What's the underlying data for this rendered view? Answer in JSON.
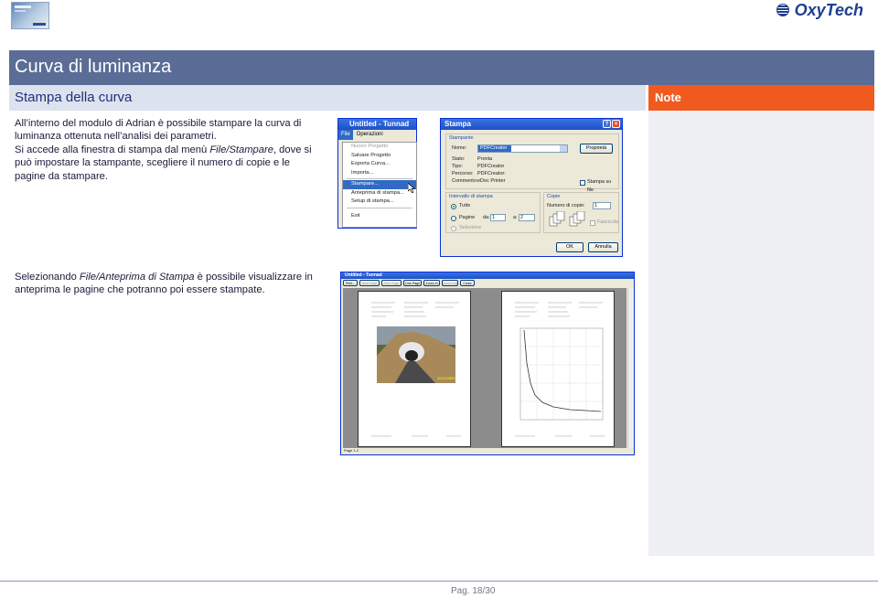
{
  "header": {
    "brand": "OxyTech",
    "logo_text": "OxyTech"
  },
  "slide": {
    "title": "Curva di luminanza",
    "subtitle": "Stampa della curva",
    "note_label": "Note",
    "para1_line1": "All’interno del modulo di Adrian è possibile stampare la curva di",
    "para1_line2": "luminanza ottenuta nell’analisi dei parametri.",
    "para2_line1_a": "Si accede alla finestra di stampa dal menù ",
    "para2_line1_em": "File/Stampare",
    "para2_line1_b": ", dove si",
    "para2_line2": "può impostare la stampante, scegliere il numero di copie e le",
    "para2_line3": "pagine da stampare.",
    "para3_line1_a": "Selezionando ",
    "para3_line1_em": "File/Anteprima di Stampa",
    "para3_line1_b": " è possibile visualizzare in",
    "para3_line2": "anteprima le pagine che potranno poi essere stampate."
  },
  "menu_window": {
    "title": "Untitled - Tunnad",
    "menu_file": "File",
    "menu_ops": "Operazioni",
    "items": [
      "Nuovo Progetto",
      "Salvare Progetto",
      "Esporta Curva...",
      "Importa...",
      "Stampare...",
      "Anteprima di stampa...",
      "Setup di stampa...",
      "Exit"
    ]
  },
  "print_dialog": {
    "title": "Stampa",
    "group_printer": "Stampante",
    "name_label": "Nome:",
    "name_value": "PDFCreator",
    "properties_btn": "Proprietà",
    "status_label": "Stato:",
    "status_value": "Pronta",
    "type_label": "Tipo:",
    "type_value": "PDFCreator",
    "path_label": "Percorso:",
    "path_value": "PDFCreator:",
    "comment_label": "Commento:",
    "comment_value": "eDoc Printer",
    "print_to_file": "Stampa su file",
    "range_group": "Intervallo di stampa",
    "all_option": "Tutte",
    "pages_option": "Pagine",
    "from_label": "da:",
    "from_value": "1",
    "to_label": "a:",
    "to_value": "2",
    "selection_option": "Selezione",
    "copies_group": "Copie",
    "copies_label": "Numero di copie:",
    "copies_value": "1",
    "collate": "Fascicola",
    "ok_btn": "OK",
    "cancel_btn": "Annulla"
  },
  "preview_window": {
    "title": "Untitled - Tunnad",
    "toolbar": [
      "Print...",
      "Next Page",
      "Prev Page",
      "One Page",
      "Zoom In",
      "Zoom Out",
      "Close"
    ],
    "photo_date": "11/11/2009",
    "status": "Page 1-2"
  },
  "footer": {
    "page": "Pag. 18/30"
  },
  "colors": {
    "title_bar": "#5b6d96",
    "subtitle_bar": "#dde3ee",
    "note_bar": "#f15a1e",
    "brand": "#1f3f8f"
  }
}
